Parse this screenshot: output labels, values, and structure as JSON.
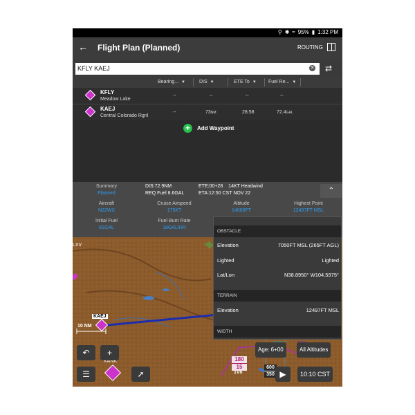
{
  "status": {
    "battery": "95%",
    "time": "1:32 PM"
  },
  "appbar": {
    "back": "←",
    "title": "Flight Plan (Planned)",
    "routing": "ROUTING"
  },
  "route": {
    "value": "KFLY KAEJ"
  },
  "columns": [
    "Bearing...",
    "DIS",
    "ETE To",
    "Fuel Re..."
  ],
  "waypoints": [
    {
      "id": "KFLY",
      "name": "Meadow Lake",
      "bearing": "--",
      "dis": "--",
      "ete": "--",
      "fuel": "--"
    },
    {
      "id": "KAEJ",
      "name": "Central Colorado Rgnl",
      "bearing": "--",
      "dis": "73",
      "dis_unit": "NM",
      "ete": "28:58",
      "fuel": "72.4",
      "fuel_unit": "GAL"
    }
  ],
  "add_waypoint": "Add Waypoint",
  "summary": {
    "summary_label": "Summary",
    "summary_value": "Planned",
    "dis": "DIS:72.9NM",
    "req_fuel": "REQ Fuel 8.6GAL",
    "ete": "ETE:00+28",
    "headwind": "14KT Headwind",
    "eta": "ETA:12:50 CST NOV 22",
    "aircraft_label": "Aircraft",
    "aircraft_value": "N22WX",
    "cruise_label": "Cruise Airspeed",
    "cruise_value": "175KT",
    "altitude_label": "Altitude",
    "altitude_value": "14000FT",
    "highest_label": "Highest Point",
    "highest_value": "12497FT MSL",
    "initfuel_label": "Initial Fuel",
    "initfuel_value": "81GAL",
    "burn_label": "Fuel Burn Rate",
    "burn_value": "18GAL/HR"
  },
  "popup": {
    "obstacle": "OBSTACLE",
    "elev_label": "Elevation",
    "elev_value": "7050FT MSL (265FT AGL)",
    "lighted_label": "Lighted",
    "lighted_value": "Lighted",
    "latlon_label": "Lat/Lon",
    "latlon_value": "N38.8950° W104.5975°",
    "terrain": "TERRAIN",
    "t_elev_label": "Elevation",
    "t_elev_value": "12497FT MSL",
    "width": "WIDTH"
  },
  "map": {
    "label_kaej": "KAEJ",
    "scale": "10 NM",
    "label_kank": "KANK",
    "label_xv": "LXV",
    "age": "Age: 6+00",
    "altitudes": "All Altitudes",
    "time": "10:10 CST",
    "sector_top": "180",
    "sector_bottom": "15",
    "airway": "1V6",
    "n600": "600",
    "n350": "350"
  },
  "colors": {
    "accent": "#2f9cf0",
    "route": "#1c2cb0",
    "waypoint": "#cc33cc",
    "add": "#27c24c"
  }
}
